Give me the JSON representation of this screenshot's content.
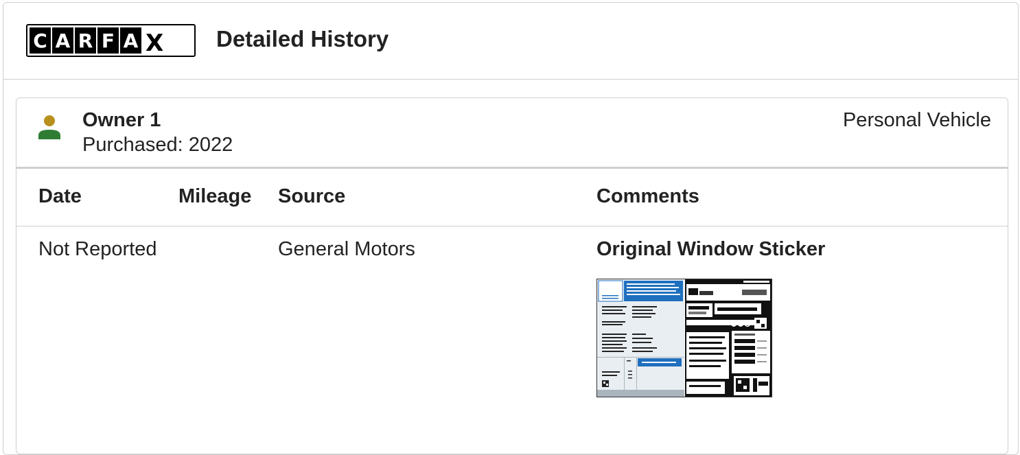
{
  "header": {
    "logo_letters": [
      "C",
      "A",
      "R",
      "F",
      "A",
      "X"
    ],
    "title": "Detailed History"
  },
  "owner": {
    "name": "Owner 1",
    "purchased": "Purchased: 2022",
    "vehicle_type": "Personal Vehicle",
    "icon": "person-icon",
    "icon_colors": {
      "head": "#b8901c",
      "body": "#2e7d32"
    }
  },
  "table": {
    "columns": [
      "Date",
      "Mileage",
      "Source",
      "Comments"
    ],
    "rows": [
      {
        "date": "Not Reported",
        "mileage": "",
        "source": "General Motors",
        "comment_title": "Original Window Sticker",
        "comment_image": "window-sticker-thumbnail"
      }
    ]
  },
  "colors": {
    "accent": "#1f6fbf",
    "border": "#cfcfcf"
  }
}
